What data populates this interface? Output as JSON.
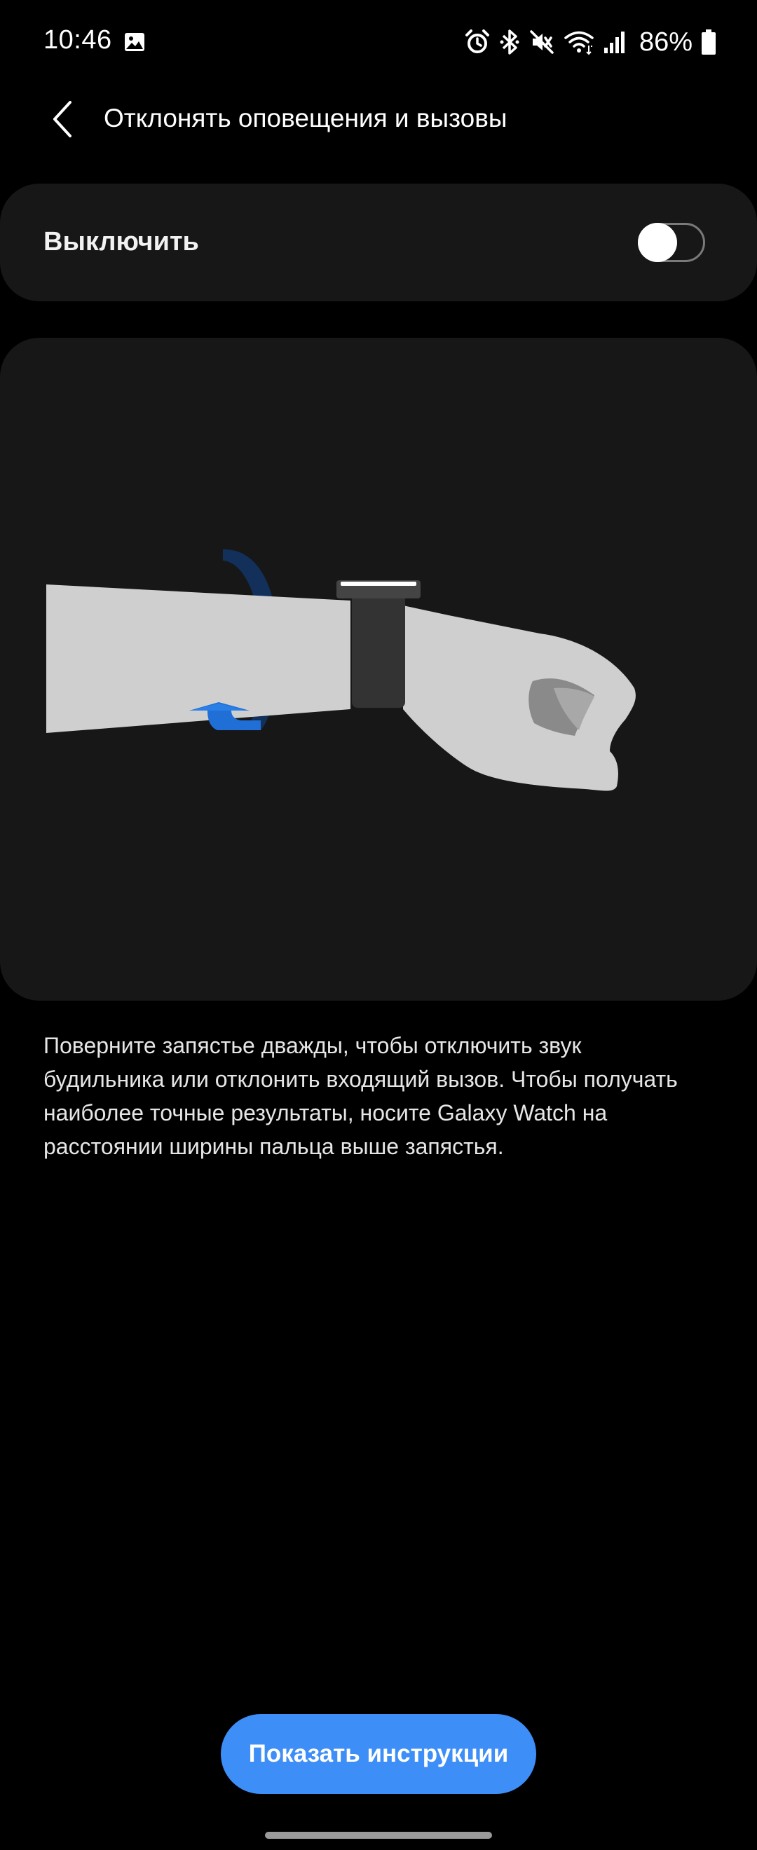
{
  "status_bar": {
    "time": "10:46",
    "battery": "86%",
    "icons": [
      "gallery-icon",
      "alarm-icon",
      "bluetooth-icon",
      "mute-icon",
      "wifi-icon",
      "signal-icon",
      "battery-icon"
    ]
  },
  "header": {
    "back_icon": "chevron-left-icon",
    "title": "Отклонять оповещения и вызовы"
  },
  "toggle": {
    "label": "Выключить",
    "state": "off"
  },
  "illustration": {
    "icons": [
      "rotating-arrow-icon",
      "arm-with-watch-illustration"
    ]
  },
  "description": "Поверните запястье дважды, чтобы отключить звук будильника или отклонить входящий вызов. Чтобы получать наиболее точные результаты, носите Galaxy Watch на расстоянии ширины пальца выше запястья.",
  "button": {
    "label": "Показать инструкции"
  },
  "colors": {
    "background": "#000000",
    "card": "#171717",
    "accent": "#3e8ef7",
    "arm": "#cfcfcf",
    "watch": "#333333",
    "arrow_light": "#1f6fd6",
    "arrow_dark": "#12305a"
  }
}
